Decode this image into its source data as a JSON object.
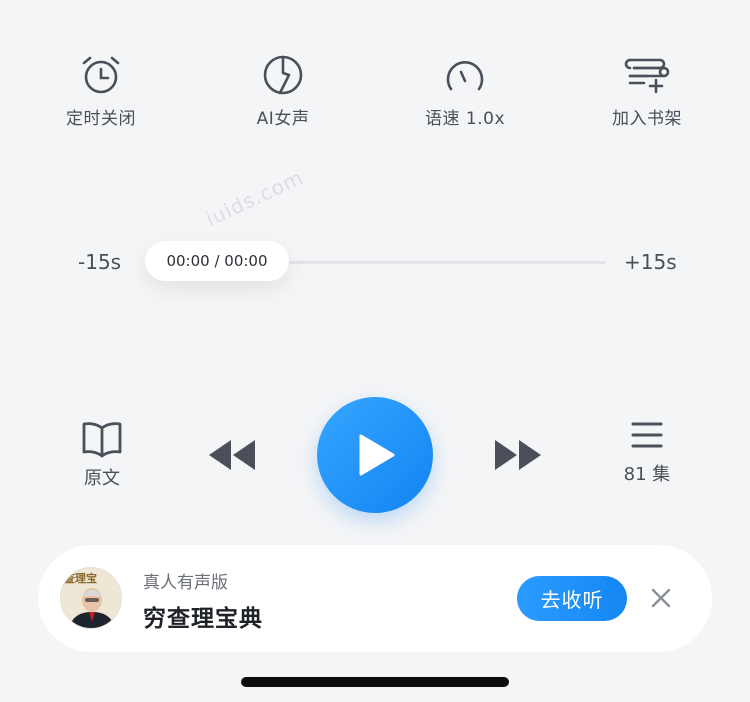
{
  "functions": [
    {
      "label": "定时关闭",
      "icon": "alarm-clock-icon"
    },
    {
      "label": "AI女声",
      "icon": "voice-wave-icon"
    },
    {
      "label": "语速 1.0x",
      "icon": "speed-gauge-icon"
    },
    {
      "label": "加入书架",
      "icon": "bookshelf-add-icon"
    }
  ],
  "watermark": "iuids.com",
  "progress": {
    "skip_back": "-15s",
    "skip_forward": "+15s",
    "time": "00:00 / 00:00",
    "fraction": 0
  },
  "controls": {
    "original_label": "原文",
    "episodes_label": "81 集",
    "play_icon": "play-icon",
    "rewind_icon": "rewind-icon",
    "forward_icon": "fast-forward-icon"
  },
  "recommend": {
    "subtitle": "真人有声版",
    "title": "穷查理宝典",
    "button": "去收听",
    "cover_text": "查理宝"
  },
  "colors": {
    "accent": "#1a8cf5",
    "background": "#f4f5f7",
    "icon": "#4a4f5a"
  }
}
